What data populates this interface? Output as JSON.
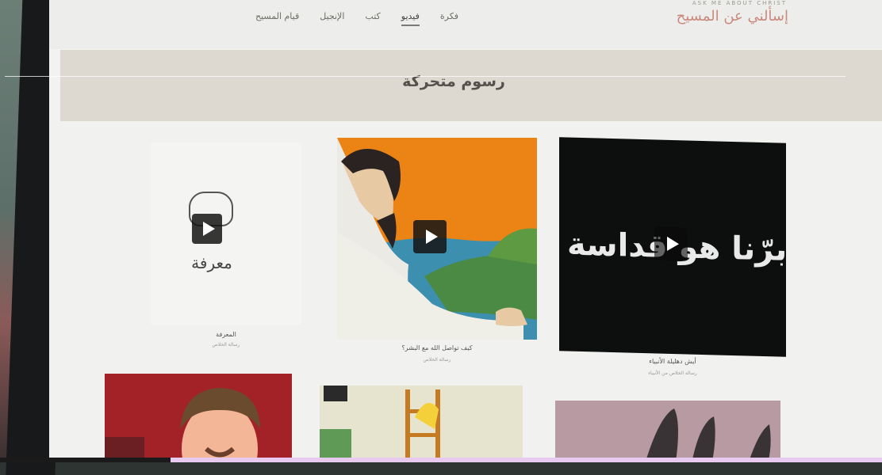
{
  "header": {
    "brand_subtitle": "ASK ME ABOUT CHRIST",
    "brand_title": "إسألني عن المسيح",
    "nav": [
      "فكرة",
      "فيديو",
      "كتب",
      "الإنجيل",
      "قيام المسيح"
    ],
    "active_nav": "فيديو"
  },
  "section": {
    "title": "رسوم متحركة"
  },
  "cards": [
    {
      "overlay_text": "هو برّنا هو قداسة",
      "title": "أيش دهليلة الأنبياء",
      "subtitle": "رسالة الخلاص من الأنبياء"
    },
    {
      "title": "كيف تواصل الله مع البشر؟",
      "subtitle": "رسالة الخلاص"
    },
    {
      "logo_text": "معرفة",
      "title": "المعرفة",
      "subtitle": "رسالة الخلاص"
    }
  ],
  "colors": {
    "accent": "#c98a7e",
    "orange": "#ec8415",
    "dark_red": "#a32228"
  },
  "icons": [
    "play-icon",
    "brain-icon"
  ]
}
